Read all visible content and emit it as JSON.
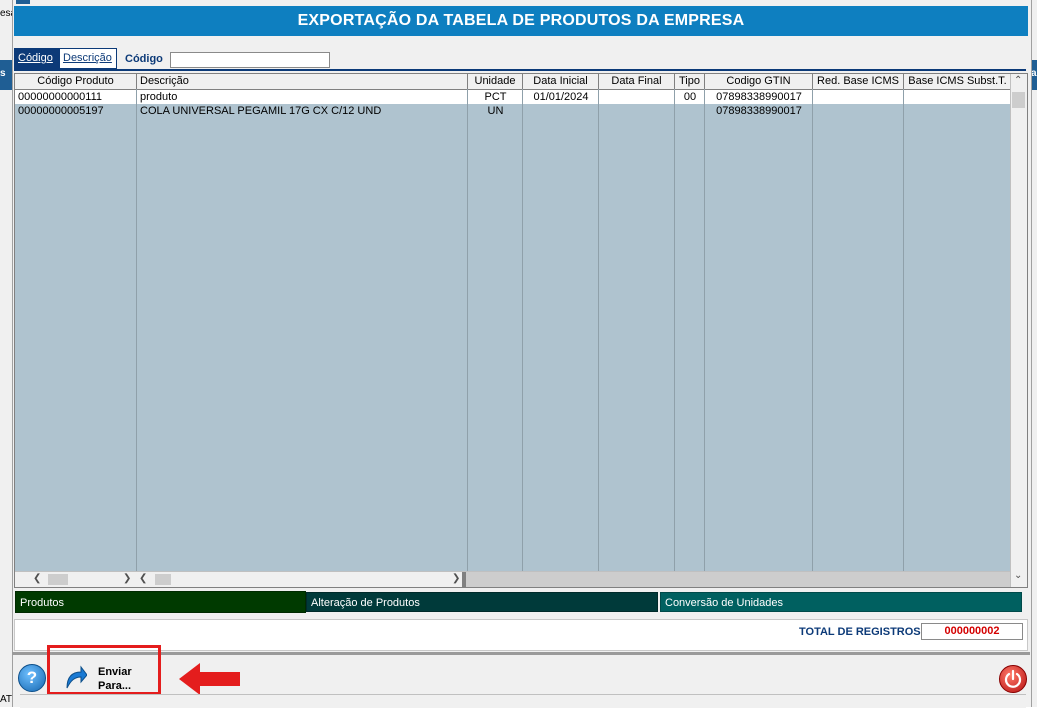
{
  "window": {
    "title": "EXPORTAÇÃO DA TABELA DE PRODUTOS DA EMPRESA"
  },
  "background_fragments": {
    "left_top": "esa",
    "left_mid": "s",
    "left_bottom": "AT",
    "right_mid": "a"
  },
  "search": {
    "tabs": [
      {
        "label": "Código",
        "active": true
      },
      {
        "label": "Descrição",
        "active": false
      }
    ],
    "label": "Código",
    "value": ""
  },
  "grid": {
    "columns": [
      "Código Produto",
      "Descrição",
      "Unidade",
      "Data Inicial",
      "Data Final",
      "Tipo",
      "Codigo GTIN",
      "Red. Base ICMS",
      "Base ICMS Subst.T."
    ],
    "rows": [
      {
        "codigo": "00000000000111",
        "descricao": "produto",
        "unidade": "PCT",
        "data_inicial": "01/01/2024",
        "data_final": "",
        "tipo": "00",
        "gtin": "07898338990017",
        "red_base": "",
        "base_st": ""
      },
      {
        "codigo": "00000000005197",
        "descricao": "COLA UNIVERSAL PEGAMIL 17G CX C/12 UND",
        "unidade": "UN",
        "data_inicial": "",
        "data_final": "",
        "tipo": "",
        "gtin": "07898338990017",
        "red_base": "",
        "base_st": ""
      }
    ]
  },
  "bottom_tabs": [
    {
      "label": "Produtos",
      "color": "#003a00"
    },
    {
      "label": "Alteração de Produtos",
      "color": "#003a3a"
    },
    {
      "label": "Conversão de Unidades",
      "color": "#006060"
    }
  ],
  "total": {
    "label": "TOTAL DE REGISTROS:",
    "value": "000000002"
  },
  "toolbar": {
    "help": "?",
    "send_line1": "Enviar",
    "send_line2": "Para..."
  },
  "colors": {
    "title_bg": "#0e7fc0",
    "grid_bg": "#afc3cf",
    "highlight": "#e41d1d"
  }
}
